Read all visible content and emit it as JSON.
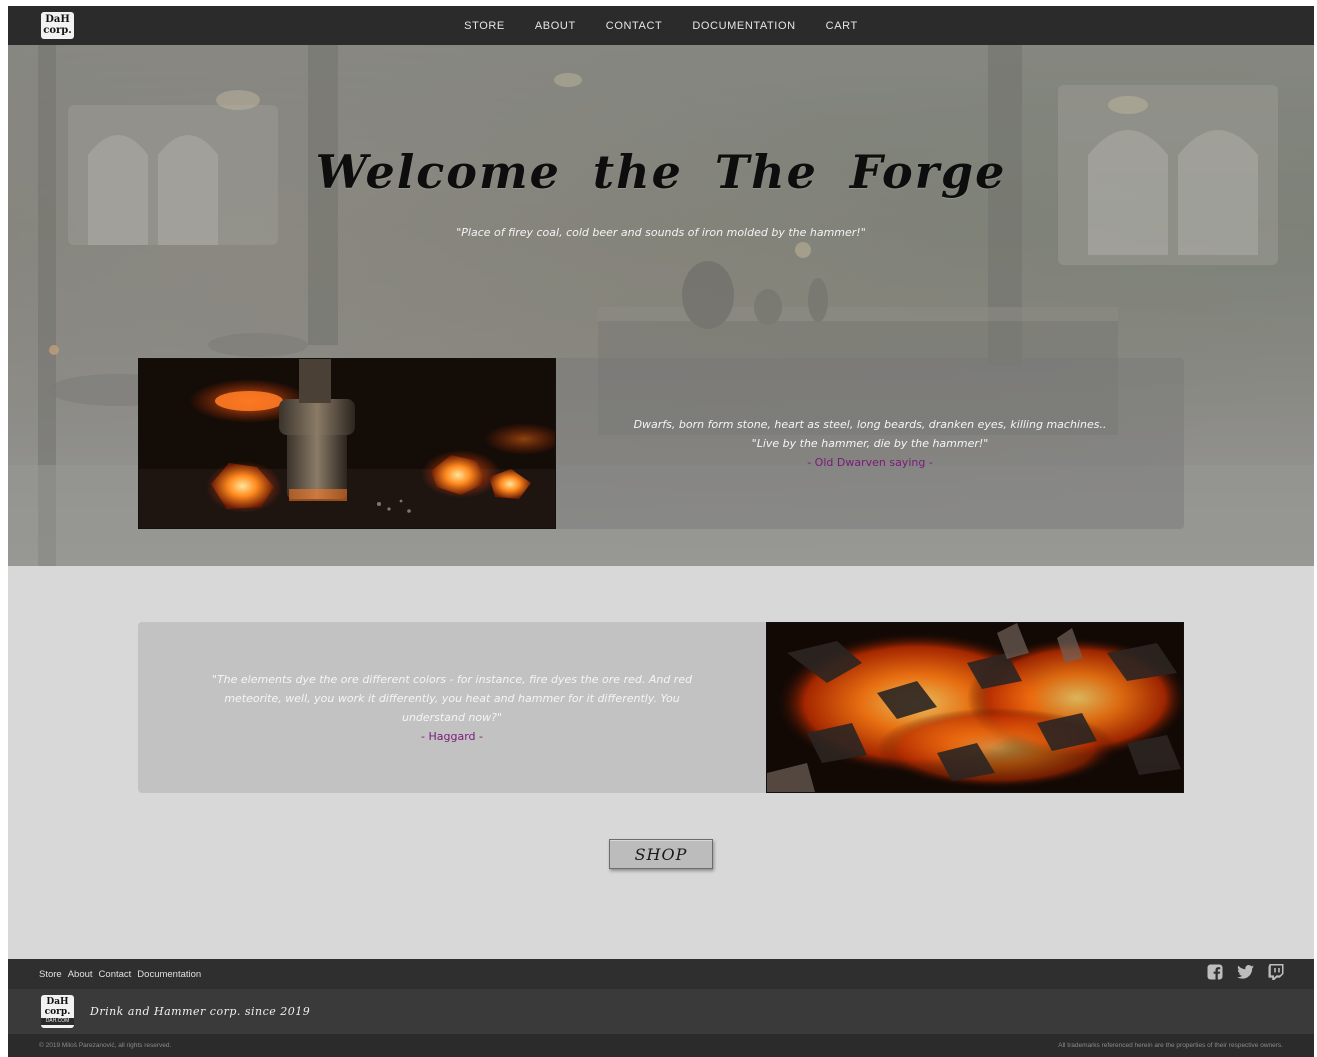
{
  "nav": {
    "logo_text_top": "DaH",
    "logo_text_bottom": "corp.",
    "links": [
      {
        "label": "STORE"
      },
      {
        "label": "ABOUT"
      },
      {
        "label": "CONTACT"
      },
      {
        "label": "DOCUMENTATION"
      },
      {
        "label": "CART"
      }
    ]
  },
  "hero": {
    "title": "Welcome the The Forge",
    "subtitle": "\"Place of firey coal, cold beer and sounds of iron molded by the hammer!\""
  },
  "feature1": {
    "image": "hammer-on-hot-coals",
    "line1": "Dwarfs, born form stone, heart as steel, long beards, dranken eyes, killing machines..",
    "line2": "\"Live by the hammer, die by the hammer!\"",
    "author": "- Old Dwarven saying -"
  },
  "feature2": {
    "image": "burning-embers",
    "quote": "\"The elements dye the ore different colors - for instance, fire dyes the ore red. And red meteorite, well, you work it differently, you heat and hammer for it differently. You understand now?\"",
    "author": "- Haggard -"
  },
  "shop_button": {
    "label": "SHOP"
  },
  "footer": {
    "links": [
      {
        "label": "Store"
      },
      {
        "label": "About"
      },
      {
        "label": "Contact"
      },
      {
        "label": "Documentation"
      }
    ],
    "social_icons": [
      "facebook-icon",
      "twitter-icon",
      "twitch-icon"
    ],
    "logo_text_top": "DaH",
    "logo_text_bottom": "corp.",
    "logo_domain": "DAH.COM",
    "tagline": "Drink and Hammer corp. since 2019",
    "copyright": "© 2019 Miloš Parezanović, all rights reserved.",
    "trademark": "All trademarks referenced herein are the properties of their respective owners."
  },
  "colors": {
    "nav_bg": "#2b2b2b",
    "page_bg": "#d8d8d8",
    "author_purple": "#7a1a7a",
    "footer_bg": "#2f2f2f"
  }
}
